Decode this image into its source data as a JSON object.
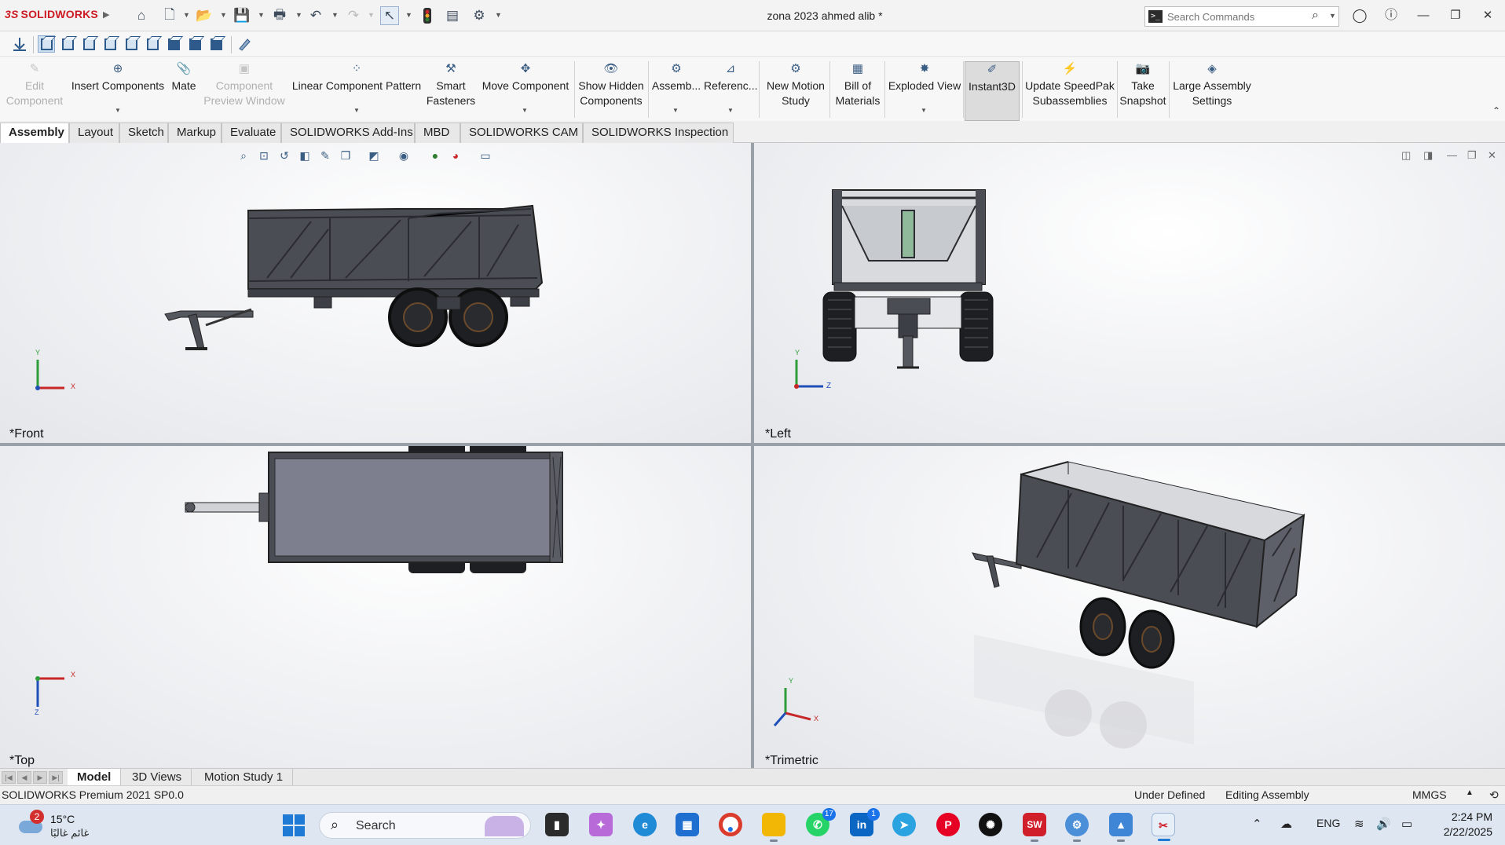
{
  "titlebar": {
    "brand_ds": "3S",
    "brand_name": "SOLIDWORKS",
    "document_title": "zona 2023 ahmed alib *",
    "search_placeholder": "Search Commands"
  },
  "ribbon": {
    "buttons": [
      {
        "line1": "Edit",
        "line2": "Component",
        "state": "disabled"
      },
      {
        "line1": "Insert Components",
        "line2": "",
        "state": "normal"
      },
      {
        "line1": "Mate",
        "line2": "",
        "state": "normal"
      },
      {
        "line1": "Component",
        "line2": "Preview Window",
        "state": "disabled"
      },
      {
        "line1": "Linear Component Pattern",
        "line2": "",
        "state": "normal"
      },
      {
        "line1": "Smart",
        "line2": "Fasteners",
        "state": "normal"
      },
      {
        "line1": "Move Component",
        "line2": "",
        "state": "normal"
      },
      {
        "line1": "Show Hidden",
        "line2": "Components",
        "state": "normal"
      },
      {
        "line1": "Assemb...",
        "line2": "",
        "state": "normal"
      },
      {
        "line1": "Referenc...",
        "line2": "",
        "state": "normal"
      },
      {
        "line1": "New Motion",
        "line2": "Study",
        "state": "normal"
      },
      {
        "line1": "Bill of",
        "line2": "Materials",
        "state": "normal"
      },
      {
        "line1": "Exploded View",
        "line2": "",
        "state": "normal"
      },
      {
        "line1": "Instant3D",
        "line2": "",
        "state": "active"
      },
      {
        "line1": "Update SpeedPak",
        "line2": "Subassemblies",
        "state": "normal"
      },
      {
        "line1": "Take",
        "line2": "Snapshot",
        "state": "normal"
      },
      {
        "line1": "Large Assembly",
        "line2": "Settings",
        "state": "normal"
      }
    ]
  },
  "tabs": [
    "Assembly",
    "Layout",
    "Sketch",
    "Markup",
    "Evaluate",
    "SOLIDWORKS Add-Ins",
    "MBD",
    "SOLIDWORKS CAM",
    "SOLIDWORKS Inspection"
  ],
  "active_tab": "Assembly",
  "viewports": {
    "front": {
      "label": "*Front",
      "axis1": "Y",
      "axis2": "X"
    },
    "left": {
      "label": "*Left",
      "axis1": "Y",
      "axis2": "Z"
    },
    "top": {
      "label": "*Top",
      "axis1": "X",
      "axis2": "Z"
    },
    "trimetric": {
      "label": "*Trimetric",
      "axis1": "Y",
      "axis2": "X"
    }
  },
  "bottom_tabs": [
    "Model",
    "3D Views",
    "Motion Study 1"
  ],
  "status": {
    "product": "SOLIDWORKS Premium 2021 SP0.0",
    "definition": "Under Defined",
    "mode": "Editing Assembly",
    "units": "MMGS"
  },
  "taskbar": {
    "weather_badge": "2",
    "temperature": "15°C",
    "location": "غائم غالبًا",
    "search_label": "Search",
    "whatsapp_badge": "17",
    "linkedin_badge": "1",
    "language": "ENG",
    "time": "2:24 PM",
    "date": "2/22/2025"
  },
  "colors": {
    "brand_red": "#cc1a22",
    "model_gray": "#4a4d54",
    "top_panel": "#7e7f8e",
    "accent_blue": "#1f7ad6"
  }
}
